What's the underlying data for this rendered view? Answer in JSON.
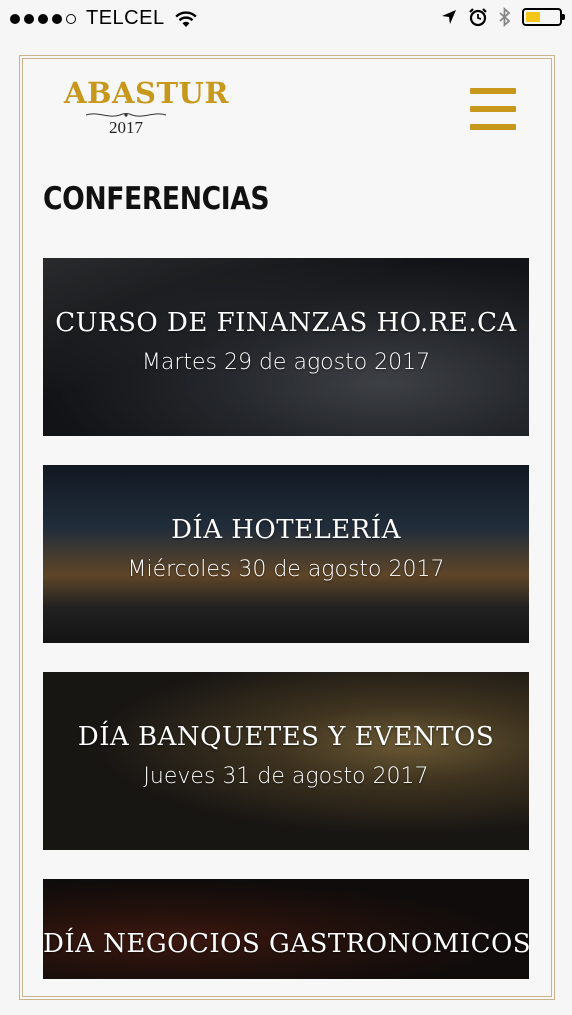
{
  "status_bar": {
    "carrier": "TELCEL",
    "battery_level": 0.45,
    "battery_color": "#f5c518"
  },
  "header": {
    "logo_text": "ABASTUR",
    "logo_year": "2017",
    "menu_icon": "hamburger-menu-icon",
    "accent_color": "#c8981c"
  },
  "page": {
    "title": "CONFERENCIAS"
  },
  "cards": [
    {
      "title": "CURSO DE FINANZAS HO.RE.CA",
      "date": "Martes 29 de agosto 2017"
    },
    {
      "title": "DÍA HOTELERÍA",
      "date": "Miércoles 30 de agosto 2017"
    },
    {
      "title": "DÍA BANQUETES Y EVENTOS",
      "date": "Jueves 31 de agosto 2017"
    },
    {
      "title": "DÍA NEGOCIOS GASTRONOMICOS",
      "date": ""
    }
  ]
}
